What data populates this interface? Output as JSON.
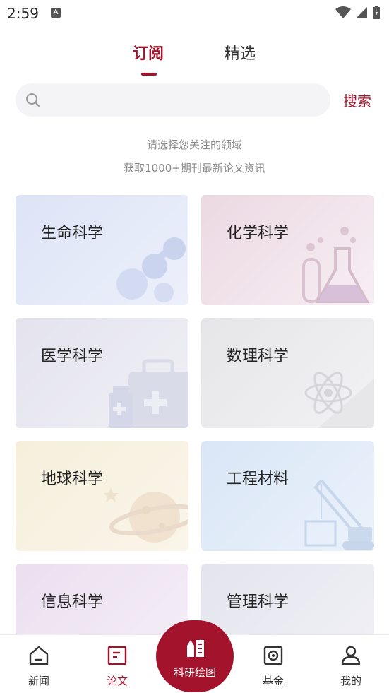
{
  "status_bar": {
    "time": "2:59",
    "indicator": "A"
  },
  "tabs": [
    {
      "label": "订阅",
      "active": true
    },
    {
      "label": "精选",
      "active": false
    }
  ],
  "search": {
    "placeholder": "",
    "button_label": "搜索"
  },
  "hint": {
    "line1": "请选择您关注的领域",
    "line2": "获取1000+期刊最新论文资讯"
  },
  "categories": [
    {
      "label": "生命科学",
      "icon": "molecule-icon"
    },
    {
      "label": "化学科学",
      "icon": "flask-icon"
    },
    {
      "label": "医学科学",
      "icon": "medical-kit-icon"
    },
    {
      "label": "数理科学",
      "icon": "atom-icon"
    },
    {
      "label": "地球科学",
      "icon": "planet-icon"
    },
    {
      "label": "工程材料",
      "icon": "crane-icon"
    },
    {
      "label": "信息科学",
      "icon": "cloud-icon"
    },
    {
      "label": "管理科学",
      "icon": "cloud-icon"
    }
  ],
  "bottom_nav": {
    "news": "新闻",
    "paper": "论文",
    "drawing": "科研绘图",
    "fund": "基金",
    "mine": "我的"
  },
  "colors": {
    "accent": "#a3132b"
  }
}
